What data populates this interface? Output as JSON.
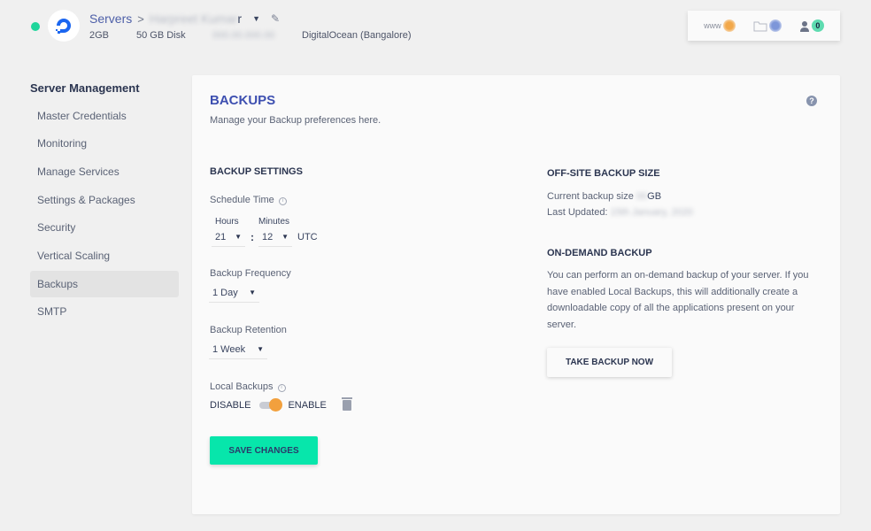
{
  "header": {
    "status_color": "#1fd59b",
    "breadcrumb_root": "Servers",
    "breadcrumb_sep": ">",
    "server_name_redacted": "Harpreet Kumar",
    "server_name_visible_end": "r",
    "caret": "▼",
    "edit_icon": "✎",
    "ram": "2GB",
    "disk": "50 GB Disk",
    "ip_redacted": "000.00.000.00",
    "provider": "DigitalOcean (Bangalore)"
  },
  "top_widget": {
    "www_label": "www",
    "user_count": "0"
  },
  "sidebar": {
    "title": "Server Management",
    "items": [
      {
        "label": "Master Credentials",
        "active": false
      },
      {
        "label": "Monitoring",
        "active": false
      },
      {
        "label": "Manage Services",
        "active": false
      },
      {
        "label": "Settings & Packages",
        "active": false
      },
      {
        "label": "Security",
        "active": false
      },
      {
        "label": "Vertical Scaling",
        "active": false
      },
      {
        "label": "Backups",
        "active": true
      },
      {
        "label": "SMTP",
        "active": false
      }
    ]
  },
  "main": {
    "title": "BACKUPS",
    "subtitle": "Manage your Backup preferences here.",
    "help_icon": "?",
    "settings": {
      "heading": "BACKUP SETTINGS",
      "schedule_label": "Schedule Time",
      "hours_label": "Hours",
      "minutes_label": "Minutes",
      "hours_value": "21",
      "minutes_value": "12",
      "colon": ":",
      "timezone": "UTC",
      "frequency_label": "Backup Frequency",
      "frequency_value": "1 Day",
      "retention_label": "Backup Retention",
      "retention_value": "1 Week",
      "local_label": "Local Backups",
      "disable_label": "DISABLE",
      "enable_label": "ENABLE",
      "local_enabled": true,
      "save_label": "SAVE CHANGES"
    },
    "offsite": {
      "heading": "OFF-SITE BACKUP SIZE",
      "current_prefix": "Current backup size",
      "current_value_redacted": "00",
      "current_unit": "GB",
      "last_updated_prefix": "Last Updated:",
      "last_updated_redacted": "15th January, 2020"
    },
    "ondemand": {
      "heading": "ON-DEMAND BACKUP",
      "description": "You can perform an on-demand backup of your server. If you have enabled Local Backups, this will additionally create a downloadable copy of all the applications present on your server.",
      "button_label": "TAKE BACKUP NOW"
    },
    "arrow": "▼",
    "info": "i"
  }
}
